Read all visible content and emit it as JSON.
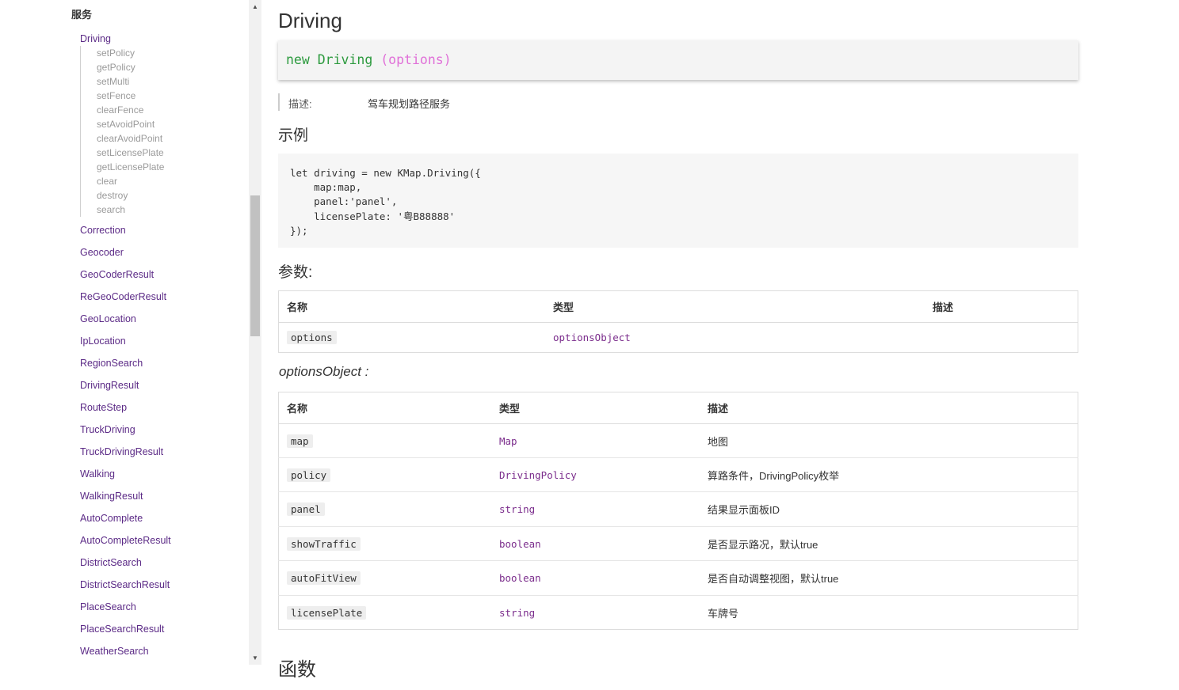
{
  "sidebar": {
    "section_title": "服务",
    "active_item": "Driving",
    "sub_items": [
      "setPolicy",
      "getPolicy",
      "setMulti",
      "setFence",
      "clearFence",
      "setAvoidPoint",
      "clearAvoidPoint",
      "setLicensePlate",
      "getLicensePlate",
      "clear",
      "destroy",
      "search"
    ],
    "items": [
      "Correction",
      "Geocoder",
      "GeoCoderResult",
      "ReGeoCoderResult",
      "GeoLocation",
      "IpLocation",
      "RegionSearch",
      "DrivingResult",
      "RouteStep",
      "TruckDriving",
      "TruckDrivingResult",
      "Walking",
      "WalkingResult",
      "AutoComplete",
      "AutoCompleteResult",
      "DistrictSearch",
      "DistrictSearchResult",
      "PlaceSearch",
      "PlaceSearchResult",
      "WeatherSearch"
    ]
  },
  "scrollbar": {
    "up_icon": "▲",
    "down_icon": "▼"
  },
  "main": {
    "title": "Driving",
    "signature": {
      "keyword": "new",
      "name": "Driving",
      "params": "(options)"
    },
    "description_label": "描述:",
    "description_value": "驾车规划路径服务",
    "example_heading": "示例",
    "example_code": "let driving = new KMap.Driving({\n    map:map,\n    panel:'panel',\n    licensePlate: '粤B88888'\n});",
    "params_heading": "参数:",
    "params_table": {
      "headers": [
        "名称",
        "类型",
        "描述"
      ],
      "rows": [
        {
          "name": "options",
          "type": "optionsObject",
          "desc": ""
        }
      ]
    },
    "options_heading": "optionsObject :",
    "options_table": {
      "headers": [
        "名称",
        "类型",
        "描述"
      ],
      "rows": [
        {
          "name": "map",
          "type": "Map",
          "desc": "地图"
        },
        {
          "name": "policy",
          "type": "DrivingPolicy",
          "desc": "算路条件，DrivingPolicy枚举"
        },
        {
          "name": "panel",
          "type": "string",
          "desc": "结果显示面板ID"
        },
        {
          "name": "showTraffic",
          "type": "boolean",
          "desc": "是否显示路况，默认true"
        },
        {
          "name": "autoFitView",
          "type": "boolean",
          "desc": "是否自动调整视图，默认true"
        },
        {
          "name": "licensePlate",
          "type": "string",
          "desc": "车牌号"
        }
      ]
    },
    "functions_heading": "函数"
  }
}
